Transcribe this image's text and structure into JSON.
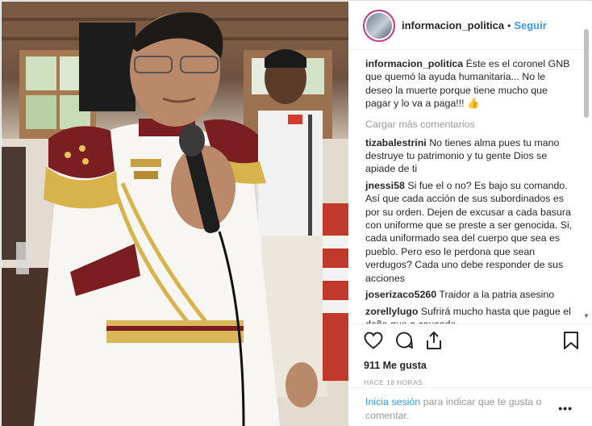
{
  "post": {
    "username": "informacion_politica",
    "separator": "•",
    "follow_label": "Seguir",
    "caption": {
      "user": "informacion_politica",
      "text": "Éste es el coronel GNB que quemó la ayuda humanitaria... No le deseo la muerte porque tiene mucho que pagar y lo va a paga!!! 👍"
    },
    "load_more_label": "Cargar más comentarios",
    "comments": [
      {
        "user": "tizabalestrini",
        "text": "No tienes alma pues tu mano destruye tu patrimonio y tu gente Dios se apiade de ti"
      },
      {
        "user": "jnessi58",
        "text": "Si fue el o no? Es bajo su comando. Así que cada acción de sus subordinados es por su orden. Dejen de excusar a cada basura con uniforme que se preste a ser genocida. Si, cada uniformado sea del cuerpo que sea es pueblo. Pero eso le perdona que sean verdugos? Cada uno debe responder de sus acciones"
      },
      {
        "user": "joserizaco5260",
        "text": "Traidor a la patria asesino"
      },
      {
        "user": "zorellylugo",
        "text": "Sufrirá mucho hasta que pague el daño que a causado"
      }
    ],
    "likes": "911 Me gusta",
    "timestamp": "HACE 18 HORAS",
    "footer": {
      "login_link": "Inicia sesión",
      "login_text": " para indicar que te gusta o comentar.",
      "more_label": "•••"
    }
  },
  "icons": {
    "like": "heart-icon",
    "comment": "comment-icon",
    "share": "share-icon",
    "save": "bookmark-icon",
    "more": "more-options-icon"
  },
  "colors": {
    "link": "#3897f0",
    "story_ring": "#c13584",
    "muted": "#999999",
    "text": "#262626"
  }
}
